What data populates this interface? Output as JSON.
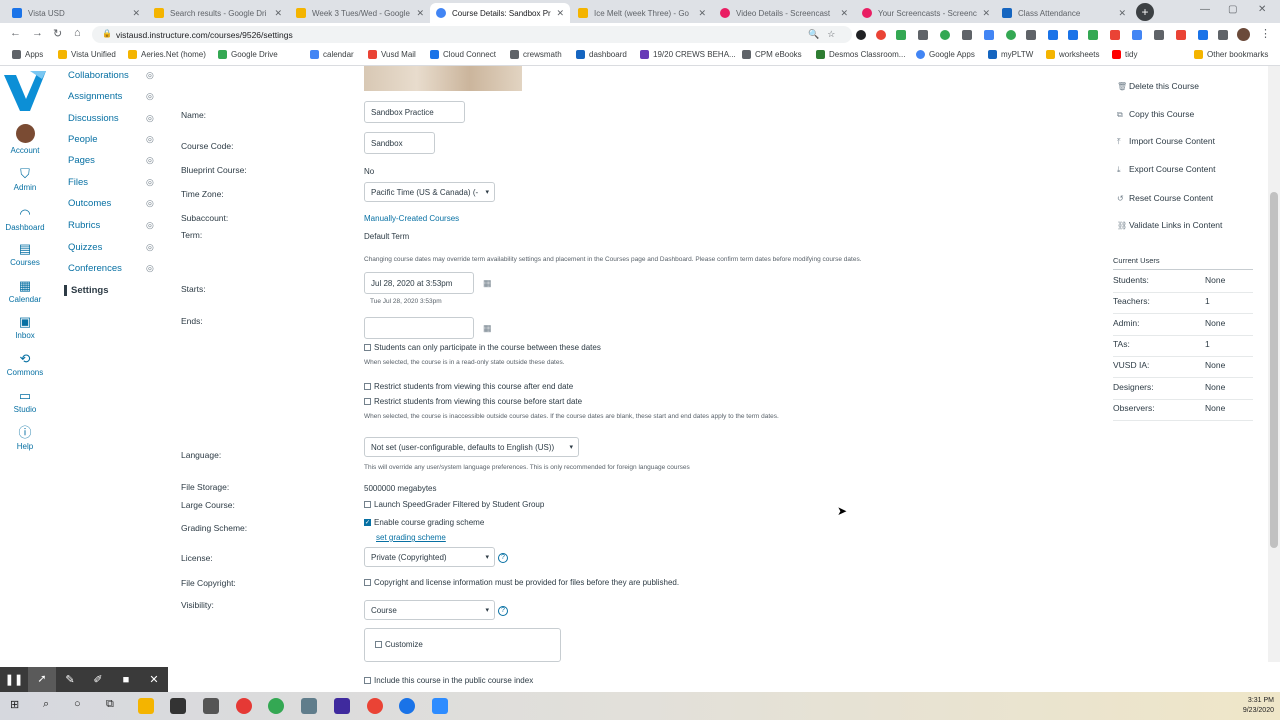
{
  "browser": {
    "tabs": [
      {
        "title": "Vista USD",
        "color": "#1a73e8"
      },
      {
        "title": "Search results - Google Dri",
        "color": "#f4b400"
      },
      {
        "title": "Week 3 Tues/Wed - Google",
        "color": "#f4b400"
      },
      {
        "title": "Course Details: Sandbox Pr",
        "color": "#4285f4"
      },
      {
        "title": "Ice Melt (week Three) - Go",
        "color": "#f4b400"
      },
      {
        "title": "Video Details - Screencast",
        "color": "#e91e63"
      },
      {
        "title": "Your Screencasts - Screenc",
        "color": "#e91e63"
      },
      {
        "title": "Class Attendance",
        "color": "#1565c0"
      }
    ],
    "new_tab": "+",
    "win_min": "—",
    "win_max": "▢",
    "win_close": "✕",
    "url": "vistausd.instructure.com/courses/9526/settings",
    "bookmarks": [
      {
        "label": "Apps",
        "color": "#5f6368"
      },
      {
        "label": "Vista Unified",
        "color": "#f4b400"
      },
      {
        "label": "Aeries.Net (home)",
        "color": "#f4b400"
      },
      {
        "label": "Google Drive",
        "color": "#34a853"
      },
      {
        "label": "calendar",
        "color": "#4285f4"
      },
      {
        "label": "Vusd Mail",
        "color": "#ea4335"
      },
      {
        "label": "Cloud Connect",
        "color": "#1a73e8"
      },
      {
        "label": "crewsmath",
        "color": "#5f6368"
      },
      {
        "label": "dashboard",
        "color": "#1565c0"
      },
      {
        "label": "19/20 CREWS BEHA...",
        "color": "#673ab7"
      },
      {
        "label": "CPM eBooks",
        "color": "#5f6368"
      },
      {
        "label": "Desmos Classroom...",
        "color": "#2e7d32"
      },
      {
        "label": "Google Apps",
        "color": "#4285f4"
      },
      {
        "label": "myPLTW",
        "color": "#1565c0"
      },
      {
        "label": "worksheets",
        "color": "#f4b400"
      },
      {
        "label": "tidy",
        "color": "#ff0000"
      },
      {
        "label": "Other bookmarks",
        "color": "#f4b400"
      }
    ]
  },
  "global_nav": [
    {
      "label": "Account",
      "icon": "account-avatar"
    },
    {
      "label": "Admin",
      "icon": "shield-icon"
    },
    {
      "label": "Dashboard",
      "icon": "dashboard-icon"
    },
    {
      "label": "Courses",
      "icon": "courses-icon"
    },
    {
      "label": "Calendar",
      "icon": "calendar-icon"
    },
    {
      "label": "Inbox",
      "icon": "inbox-icon"
    },
    {
      "label": "Commons",
      "icon": "commons-icon"
    },
    {
      "label": "Studio",
      "icon": "studio-icon"
    },
    {
      "label": "Help",
      "icon": "help-icon"
    }
  ],
  "course_nav": [
    {
      "label": "Collaborations"
    },
    {
      "label": "Assignments"
    },
    {
      "label": "Discussions"
    },
    {
      "label": "People"
    },
    {
      "label": "Pages"
    },
    {
      "label": "Files"
    },
    {
      "label": "Outcomes"
    },
    {
      "label": "Rubrics"
    },
    {
      "label": "Quizzes"
    },
    {
      "label": "Conferences"
    },
    {
      "label": "Settings"
    }
  ],
  "form": {
    "name_label": "Name:",
    "name_value": "Sandbox Practice",
    "code_label": "Course Code:",
    "code_value": "Sandbox",
    "blueprint_label": "Blueprint Course:",
    "blueprint_value": "No",
    "timezone_label": "Time Zone:",
    "timezone_value": "Pacific Time (US & Canada) (-",
    "subaccount_label": "Subaccount:",
    "subaccount_value": "Manually-Created Courses",
    "term_label": "Term:",
    "term_value": "Default Term",
    "dates_note": "Changing course dates may override term availability settings and placement in the Courses page and Dashboard. Please confirm term dates before modifying course dates.",
    "starts_label": "Starts:",
    "starts_value": "Jul 28, 2020 at  3:53pm",
    "starts_sub": "Tue Jul 28, 2020 3:53pm",
    "ends_label": "Ends:",
    "only_between": "Students can only participate in the course between these dates",
    "only_between_note": "When selected, the course is in a read-only state outside these dates.",
    "restrict_after": "Restrict students from viewing this course after end date",
    "restrict_before": "Restrict students from viewing this course before start date",
    "restrict_note": "When selected, the course is inaccessible outside course dates. If the course dates are blank, these start and end dates apply to the term dates.",
    "language_label": "Language:",
    "language_value": "Not set (user-configurable, defaults to English (US))",
    "language_note": "This will override any user/system language preferences. This is only recommended for foreign language courses",
    "storage_label": "File Storage:",
    "storage_value": "5000000 megabytes",
    "large_label": "Large Course:",
    "large_value": "Launch SpeedGrader Filtered by Student Group",
    "grading_label": "Grading Scheme:",
    "grading_value": "Enable course grading scheme",
    "grading_link": "set grading scheme",
    "license_label": "License:",
    "license_value": "Private (Copyrighted)",
    "copyright_label": "File Copyright:",
    "copyright_value": "Copyright and license information must be provided for files before they are published.",
    "visibility_label": "Visibility:",
    "visibility_value": "Course",
    "customize": "Customize",
    "public_index": "Include this course in the public course index"
  },
  "sidebar": {
    "actions": [
      {
        "label": "Delete this Course",
        "icon": "trash-icon"
      },
      {
        "label": "Copy this Course",
        "icon": "copy-icon"
      },
      {
        "label": "Import Course Content",
        "icon": "upload-icon"
      },
      {
        "label": "Export Course Content",
        "icon": "download-icon"
      },
      {
        "label": "Reset Course Content",
        "icon": "reset-icon"
      },
      {
        "label": "Validate Links in Content",
        "icon": "link-icon"
      }
    ],
    "users_heading": "Current Users",
    "users": [
      {
        "role": "Students:",
        "count": "None"
      },
      {
        "role": "Teachers:",
        "count": "1"
      },
      {
        "role": "Admin:",
        "count": "None"
      },
      {
        "role": "TAs:",
        "count": "1"
      },
      {
        "role": "VUSD IA:",
        "count": "None"
      },
      {
        "role": "Designers:",
        "count": "None"
      },
      {
        "role": "Observers:",
        "count": "None"
      }
    ]
  },
  "taskbar": {
    "time": "3:31 PM",
    "date": "9/23/2020"
  }
}
